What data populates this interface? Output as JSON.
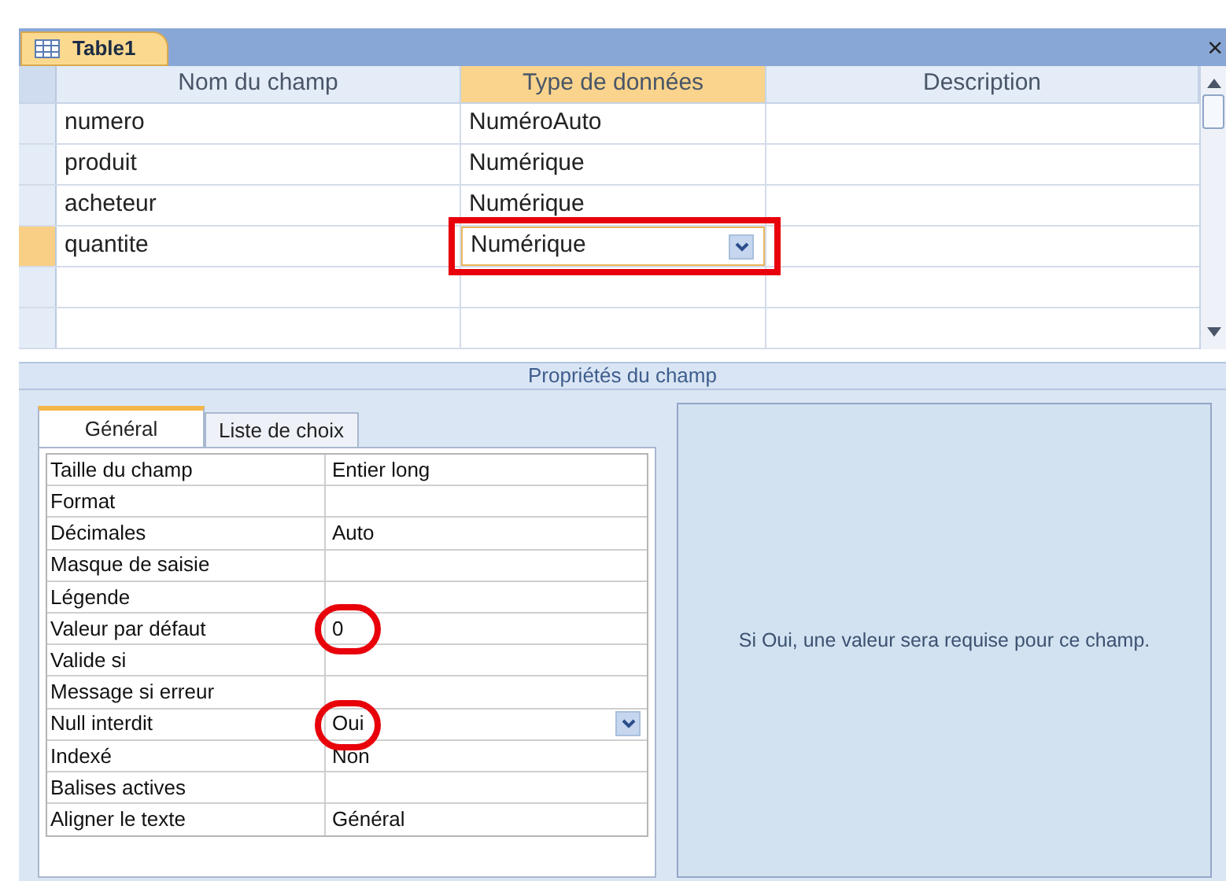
{
  "window": {
    "tab": "Table1",
    "close": "×"
  },
  "design_grid": {
    "columns": [
      "Nom du champ",
      "Type de données",
      "Description"
    ],
    "rows": [
      {
        "name": "numero",
        "type": "NuméroAuto",
        "selected": false,
        "annotated": false
      },
      {
        "name": "produit",
        "type": "Numérique",
        "selected": false,
        "annotated": false
      },
      {
        "name": "acheteur",
        "type": "Numérique",
        "selected": false,
        "annotated": false
      },
      {
        "name": "quantite",
        "type": "Numérique",
        "selected": true,
        "annotated": true
      }
    ]
  },
  "properties_band": "Propriétés du champ",
  "property_tabs": [
    {
      "label": "Général",
      "selected": true
    },
    {
      "label": "Liste de choix",
      "selected": false
    }
  ],
  "properties": [
    {
      "label": "Taille du champ",
      "value": "Entier long",
      "dropdown": false,
      "annotated": false
    },
    {
      "label": "Format",
      "dropdown": false,
      "annotated": false
    },
    {
      "label": "Décimales",
      "value": "Auto",
      "dropdown": false,
      "annotated": false
    },
    {
      "label": "Masque de saisie",
      "dropdown": false,
      "annotated": false
    },
    {
      "label": "Légende",
      "dropdown": false,
      "annotated": false
    },
    {
      "label": "Valeur par défaut",
      "value": "0",
      "dropdown": false,
      "annotated": true
    },
    {
      "label": "Valide si",
      "dropdown": false,
      "annotated": false
    },
    {
      "label": "Message si erreur",
      "dropdown": false,
      "annotated": false
    },
    {
      "label": "Null interdit",
      "value": "Oui",
      "dropdown": true,
      "annotated": true
    },
    {
      "label": "Indexé",
      "value": "Non",
      "dropdown": false,
      "annotated": false
    },
    {
      "label": "Balises actives",
      "dropdown": false,
      "annotated": false
    },
    {
      "label": "Aligner le texte",
      "value": "Général",
      "dropdown": false,
      "annotated": false
    }
  ],
  "help_text": "Si Oui, une valeur sera requise pour ce champ."
}
